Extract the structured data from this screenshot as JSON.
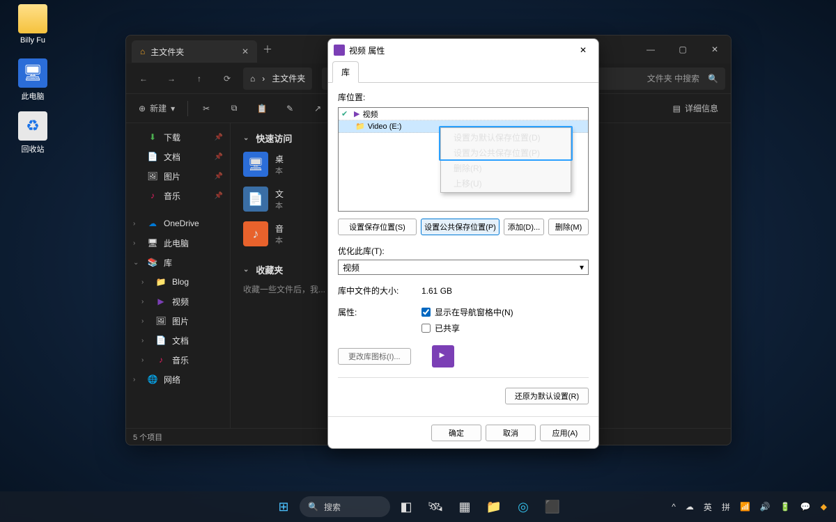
{
  "desktop": {
    "user_folder": "Billy Fu",
    "this_pc": "此电脑",
    "recycle": "回收站"
  },
  "explorer": {
    "tab_title": "主文件夹",
    "breadcrumb": "主文件夹",
    "search_placeholder": "文件夹 中搜索",
    "new_btn": "新建",
    "details_btn": "详细信息",
    "sidebar": {
      "downloads": "下载",
      "documents": "文档",
      "pictures": "图片",
      "music": "音乐",
      "onedrive": "OneDrive",
      "thispc": "此电脑",
      "libraries": "库",
      "lib_blog": "Blog",
      "lib_video": "视频",
      "lib_pic": "图片",
      "lib_doc": "文档",
      "lib_music": "音乐",
      "network": "网络"
    },
    "sections": {
      "quick": "快速访问",
      "fav": "收藏夹",
      "fav_empty": "收藏一些文件后，我...",
      "tile_desktop": "桌",
      "tile_desktop_sub": "本",
      "tile_doc": "文",
      "tile_doc_sub": "本",
      "tile_music": "音",
      "tile_music_sub": "本"
    },
    "status": "5 个项目"
  },
  "props": {
    "title": "视频 属性",
    "tab": "库",
    "loc_label": "库位置:",
    "loc_root": "视频",
    "loc_item": "Video (E:)",
    "btn_set_save": "设置保存位置(S)",
    "btn_set_public": "设置公共保存位置(P)",
    "btn_add": "添加(D)...",
    "btn_remove": "删除(M)",
    "optimize_label": "优化此库(T):",
    "optimize_value": "视频",
    "size_label": "库中文件的大小:",
    "size_value": "1.61 GB",
    "attr_label": "属性:",
    "show_nav": "显示在导航窗格中(N)",
    "shared": "已共享",
    "change_icon": "更改库图标(I)...",
    "restore": "还原为默认设置(R)",
    "ok": "确定",
    "cancel": "取消",
    "apply": "应用(A)"
  },
  "ctx": {
    "set_default": "设置为默认保存位置(D)",
    "set_public": "设置为公共保存位置(P)",
    "delete": "删除(R)",
    "move_up": "上移(U)"
  },
  "taskbar": {
    "search": "搜索",
    "ime1": "英",
    "ime2": "拼"
  }
}
